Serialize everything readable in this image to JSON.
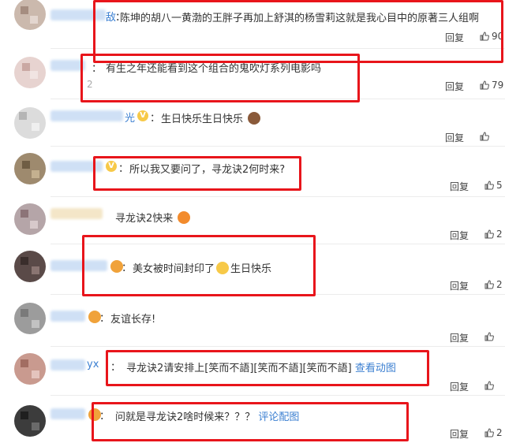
{
  "comments": [
    {
      "user_suffix": "敌",
      "text": "陈坤的胡八一黄渤的王胖子再加上舒淇的杨雪莉这就是我心目中的原著三人组啊",
      "reply": "回复",
      "likes": "90",
      "verified": false,
      "extra": ""
    },
    {
      "user_suffix": "",
      "text": "有生之年还能看到这个组合的鬼吹灯系列电影吗",
      "reply": "回复",
      "likes": "79",
      "verified": false,
      "extra": "2"
    },
    {
      "user_suffix": "光",
      "text": "生日快乐生日快乐",
      "reply": "回复",
      "likes": "",
      "verified": true,
      "extra": ""
    },
    {
      "user_suffix": "",
      "text": "所以我又要问了，寻龙诀2何时来?",
      "reply": "回复",
      "likes": "5",
      "verified": true,
      "extra": ""
    },
    {
      "user_suffix": "",
      "text": "寻龙诀2快来",
      "reply": "回复",
      "likes": "2",
      "verified": false,
      "extra": ""
    },
    {
      "user_suffix": "",
      "text_a": "美女被时间封印了",
      "text_b": "生日快乐",
      "reply": "回复",
      "likes": "2",
      "verified": false,
      "extra": ""
    },
    {
      "user_suffix": "",
      "text": "友谊长存!",
      "reply": "回复",
      "likes": "",
      "verified": false,
      "extra": ""
    },
    {
      "user_suffix": "yx",
      "text": "寻龙诀2请安排上[笑而不語][笑而不語][笑而不語]",
      "link": "查看动图",
      "reply": "回复",
      "likes": "",
      "verified": false,
      "extra": ""
    },
    {
      "user_suffix": "",
      "text": "问就是寻龙诀2啥时候来？？？",
      "link": "评论配图",
      "reply": "回复",
      "likes": "2",
      "verified": false,
      "extra": ""
    }
  ],
  "colon": "：",
  "verified_mark": "V",
  "colors": {
    "highlight": "#e8151b",
    "link": "#3b7fd1",
    "text": "#333333"
  },
  "icons": {
    "like": "thumbs-up-icon"
  }
}
